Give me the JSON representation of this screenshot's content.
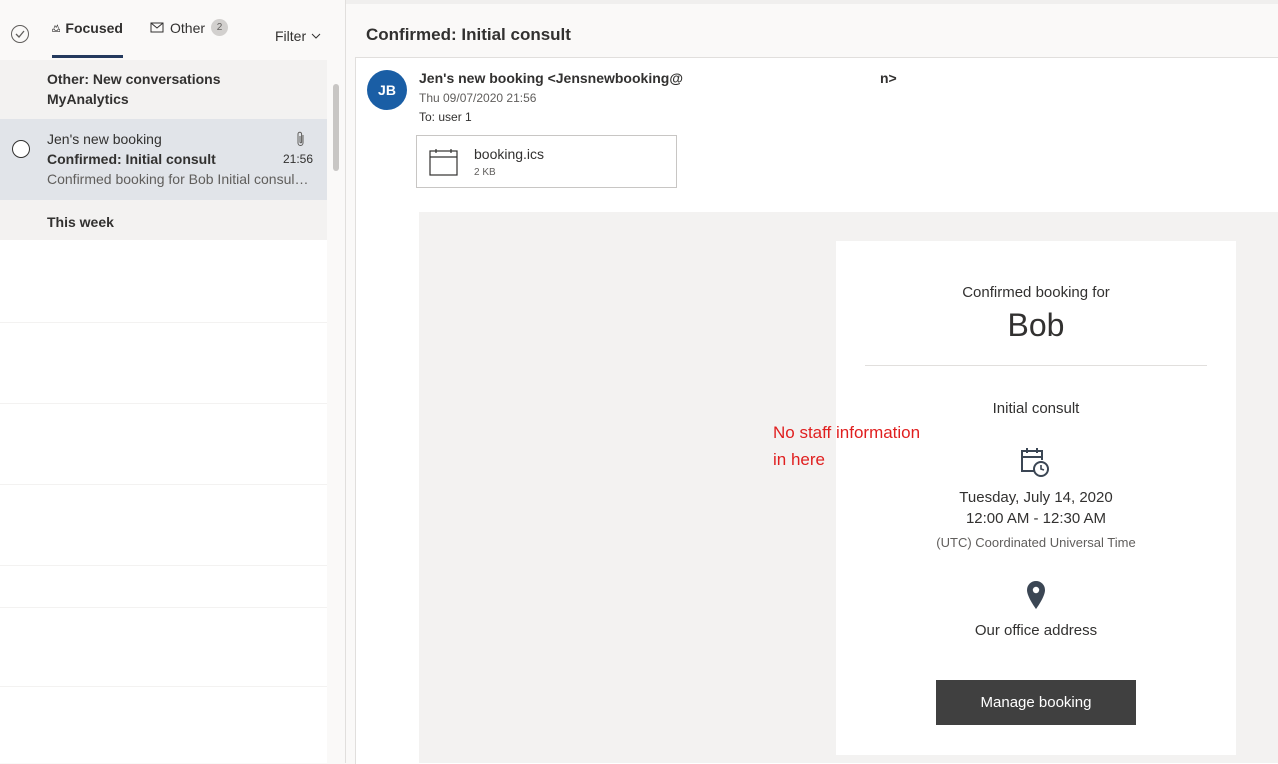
{
  "message_list": {
    "tabs": [
      {
        "label": "Focused",
        "icon": "focused-inbox-icon",
        "selected": true
      },
      {
        "label": "Other",
        "icon": "mail-icon",
        "badge": "2"
      }
    ],
    "filter_label": "Filter",
    "other_header": {
      "line1": "Other: New conversations",
      "line2": "MyAnalytics"
    },
    "selected_message": {
      "sender": "Jen's new booking",
      "subject": "Confirmed: Initial consult",
      "time": "21:56",
      "preview": "Confirmed booking for Bob Initial consult Tuesday, July 14, 2020"
    },
    "week_header": "This week"
  },
  "reading_pane": {
    "title": "Confirmed: Initial consult",
    "avatar_initials": "JB",
    "from_name": "Jen's new booking <Jensnewbooking@",
    "from_tail": "n>",
    "sent": "Thu 09/07/2020 21:56",
    "to_label": "To:",
    "to_value": "user 1",
    "attachment": {
      "name": "booking.ics",
      "size": "2 KB",
      "icon": "calendar-file-icon"
    }
  },
  "booking": {
    "intro": "Confirmed booking for",
    "customer": "Bob",
    "service": "Initial consult",
    "date": "Tuesday, July 14, 2020",
    "time": "12:00 AM - 12:30 AM",
    "timezone": "(UTC) Coordinated Universal Time",
    "location": "Our office address",
    "button_label": "Manage booking"
  },
  "annotation": {
    "line1": "No staff information",
    "line2": "in here"
  },
  "colors": {
    "avatar": "#1a5ea5",
    "selected_row": "#e1e4e9",
    "pivot_underline": "#243a5e",
    "button": "#404040",
    "annotation": "#e01f1f"
  }
}
